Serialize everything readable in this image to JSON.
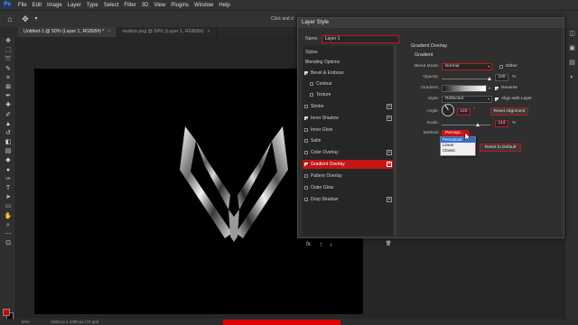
{
  "app": {
    "logo": "Ps"
  },
  "menu": [
    "File",
    "Edit",
    "Image",
    "Layer",
    "Type",
    "Select",
    "Filter",
    "3D",
    "View",
    "Plugins",
    "Window",
    "Help"
  ],
  "options_bar": {
    "hint": "Click and d"
  },
  "doc_tabs": [
    {
      "label": "Untitled-1 @ 50% (Layer 1, RGB/8#) *",
      "close": "×"
    },
    {
      "label": "euders.png @ 50% (Layer 1, RGB/8#)",
      "close": "×"
    }
  ],
  "status": {
    "zoom": "50%",
    "info": "1920 px x 1080 px (72 ppi)"
  },
  "dialog": {
    "title": "Layer Style",
    "name_label": "Name:",
    "name_value": "Layer 1",
    "styles_list": [
      {
        "label": "Styles",
        "type": "header"
      },
      {
        "label": "Blending Options",
        "type": "header"
      },
      {
        "label": "Bevel & Emboss",
        "checked": true
      },
      {
        "label": "Contour",
        "checked": false,
        "sub": true
      },
      {
        "label": "Texture",
        "checked": false,
        "sub": true
      },
      {
        "label": "Stroke",
        "checked": false,
        "plus": true
      },
      {
        "label": "Inner Shadow",
        "checked": true,
        "plus": true
      },
      {
        "label": "Inner Glow",
        "checked": false
      },
      {
        "label": "Satin",
        "checked": false
      },
      {
        "label": "Color Overlay",
        "checked": false,
        "plus": true
      },
      {
        "label": "Gradient Overlay",
        "checked": true,
        "plus": true,
        "selected": true
      },
      {
        "label": "Pattern Overlay",
        "checked": false
      },
      {
        "label": "Outer Glow",
        "checked": false
      },
      {
        "label": "Drop Shadow",
        "checked": false,
        "plus": true
      }
    ],
    "footer": {
      "fx": "fx.",
      "up": "⇑",
      "down": "⇓",
      "trash": "🗑"
    },
    "gradient_overlay": {
      "section_title": "Gradient Overlay",
      "sub_title": "Gradient",
      "blend_mode_label": "Blend Mode:",
      "blend_mode": "Normal",
      "dither_label": "Dither",
      "dither": false,
      "opacity_label": "Opacity:",
      "opacity": "100",
      "percent": "%",
      "gradient_label": "Gradient:",
      "reverse_label": "Reverse",
      "reverse": true,
      "style_label": "Style:",
      "style": "Reflected",
      "align_label": "Align with Layer",
      "align": true,
      "angle_label": "Angle:",
      "angle": "123",
      "degree": "°",
      "reset_alignment": "Reset Alignment",
      "scale_label": "Scale:",
      "scale": "113",
      "method_label": "Method:",
      "method": "Percept...",
      "reset_default": "Reset to Default",
      "method_options": [
        "Perceptual",
        "Linear",
        "Classic"
      ],
      "method_highlight": "Perceptual"
    }
  },
  "colors": {
    "accent_red": "#c41414",
    "foreground": "#d40000",
    "background": "#000000"
  }
}
